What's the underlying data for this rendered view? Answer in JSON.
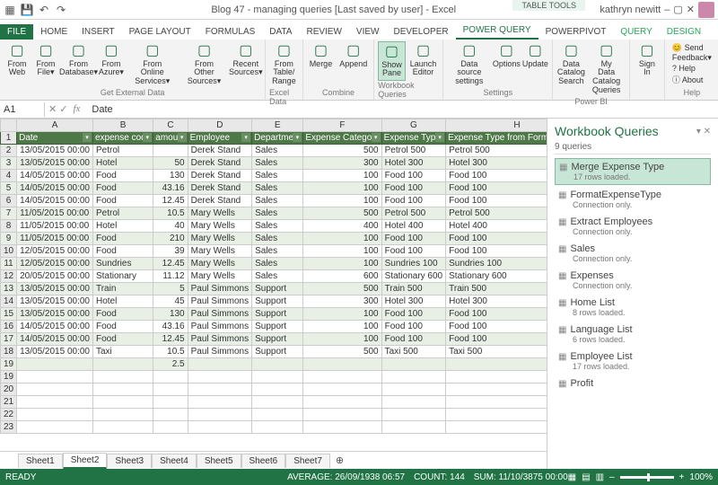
{
  "title": "Blog 47 - managing queries [Last saved by user] - Excel",
  "user": "kathryn newitt",
  "context_tab_group": "TABLE TOOLS",
  "tabs": [
    "FILE",
    "HOME",
    "INSERT",
    "PAGE LAYOUT",
    "FORMULAS",
    "DATA",
    "REVIEW",
    "VIEW",
    "DEVELOPER",
    "POWER QUERY",
    "POWERPIVOT",
    "QUERY",
    "DESIGN"
  ],
  "active_tab": "POWER QUERY",
  "ribbon": {
    "groups": [
      {
        "label": "Get External Data",
        "buttons": [
          "From Web",
          "From File▾",
          "From Database▾",
          "From Azure▾",
          "From Online Services▾",
          "From Other Sources▾",
          "Recent Sources▾"
        ]
      },
      {
        "label": "Excel Data",
        "buttons": [
          "From Table/ Range"
        ]
      },
      {
        "label": "Combine",
        "buttons": [
          "Merge",
          "Append"
        ]
      },
      {
        "label": "Workbook Queries",
        "buttons": [
          "Show Pane",
          "Launch Editor"
        ]
      },
      {
        "label": "Settings",
        "buttons": [
          "Data source settings",
          "Options",
          "Update"
        ]
      },
      {
        "label": "Power BI",
        "buttons": [
          "Data Catalog Search",
          "My Data Catalog Queries"
        ]
      },
      {
        "label": "",
        "buttons": [
          "Sign In"
        ]
      },
      {
        "label": "Help",
        "help": [
          "😊 Send Feedback▾",
          "? Help",
          "ⓘ About"
        ]
      }
    ],
    "active_button": "Show Pane"
  },
  "name_box": "A1",
  "formula": "Date",
  "columns": [
    "A",
    "B",
    "C",
    "D",
    "E",
    "F",
    "G",
    "H"
  ],
  "headers": [
    "Date",
    "expense code",
    "amount",
    "Employee",
    "Department",
    "Expense Category",
    "Expense Type",
    "Expense Type from FormatExpens"
  ],
  "rows": [
    [
      "13/05/2015 00:00",
      "Petrol",
      "",
      "Derek Stand",
      "Sales",
      "500",
      "Petrol 500",
      "Petrol 500"
    ],
    [
      "13/05/2015 00:00",
      "Hotel",
      "50",
      "Derek Stand",
      "Sales",
      "300",
      "Hotel 300",
      "Hotel 300"
    ],
    [
      "14/05/2015 00:00",
      "Food",
      "130",
      "Derek Stand",
      "Sales",
      "100",
      "Food 100",
      "Food 100"
    ],
    [
      "14/05/2015 00:00",
      "Food",
      "43.16",
      "Derek Stand",
      "Sales",
      "100",
      "Food 100",
      "Food 100"
    ],
    [
      "14/05/2015 00:00",
      "Food",
      "12.45",
      "Derek Stand",
      "Sales",
      "100",
      "Food 100",
      "Food 100"
    ],
    [
      "11/05/2015 00:00",
      "Petrol",
      "10.5",
      "Mary Wells",
      "Sales",
      "500",
      "Petrol 500",
      "Petrol 500"
    ],
    [
      "11/05/2015 00:00",
      "Hotel",
      "40",
      "Mary Wells",
      "Sales",
      "400",
      "Hotel 400",
      "Hotel 400"
    ],
    [
      "11/05/2015 00:00",
      "Food",
      "210",
      "Mary Wells",
      "Sales",
      "100",
      "Food 100",
      "Food 100"
    ],
    [
      "12/05/2015 00:00",
      "Food",
      "39",
      "Mary Wells",
      "Sales",
      "100",
      "Food 100",
      "Food 100"
    ],
    [
      "12/05/2015 00:00",
      "Sundries",
      "12.45",
      "Mary Wells",
      "Sales",
      "100",
      "Sundries 100",
      "Sundries 100"
    ],
    [
      "20/05/2015 00:00",
      "Stationary",
      "11.12",
      "Mary Wells",
      "Sales",
      "600",
      "Stationary 600",
      "Stationary 600"
    ],
    [
      "13/05/2015 00:00",
      "Train",
      "5",
      "Paul Simmons",
      "Support",
      "500",
      "Train 500",
      "Train 500"
    ],
    [
      "13/05/2015 00:00",
      "Hotel",
      "45",
      "Paul Simmons",
      "Support",
      "300",
      "Hotel 300",
      "Hotel 300"
    ],
    [
      "13/05/2015 00:00",
      "Food",
      "130",
      "Paul Simmons",
      "Support",
      "100",
      "Food 100",
      "Food 100"
    ],
    [
      "14/05/2015 00:00",
      "Food",
      "43.16",
      "Paul Simmons",
      "Support",
      "100",
      "Food 100",
      "Food 100"
    ],
    [
      "14/05/2015 00:00",
      "Food",
      "12.45",
      "Paul Simmons",
      "Support",
      "100",
      "Food 100",
      "Food 100"
    ],
    [
      "13/05/2015 00:00",
      "Taxi",
      "10.5",
      "Paul Simmons",
      "Support",
      "500",
      "Taxi 500",
      "Taxi 500"
    ],
    [
      "",
      "",
      "2.5",
      "",
      "",
      "",
      "",
      ""
    ]
  ],
  "empty_rows": [
    19,
    20,
    21,
    22,
    23
  ],
  "sheets": [
    "Sheet1",
    "Sheet2",
    "Sheet3",
    "Sheet4",
    "Sheet5",
    "Sheet6",
    "Sheet7"
  ],
  "active_sheet": "Sheet2",
  "queries_pane": {
    "title": "Workbook Queries",
    "count": "9 queries",
    "items": [
      {
        "name": "Merge Expense Type",
        "status": "17 rows loaded.",
        "active": true
      },
      {
        "name": "FormatExpenseType",
        "status": "Connection only."
      },
      {
        "name": "Extract Employees",
        "status": "Connection only."
      },
      {
        "name": "Sales",
        "status": "Connection only."
      },
      {
        "name": "Expenses",
        "status": "Connection only."
      },
      {
        "name": "Home List",
        "status": "8 rows loaded."
      },
      {
        "name": "Language List",
        "status": "6 rows loaded."
      },
      {
        "name": "Employee List",
        "status": "17 rows loaded."
      },
      {
        "name": "Profit",
        "status": ""
      }
    ]
  },
  "statusbar": {
    "ready": "READY",
    "average": "AVERAGE: 26/09/1938 06:57",
    "count": "COUNT: 144",
    "sum": "SUM: 11/10/3875 00:00",
    "zoom": "100%"
  }
}
